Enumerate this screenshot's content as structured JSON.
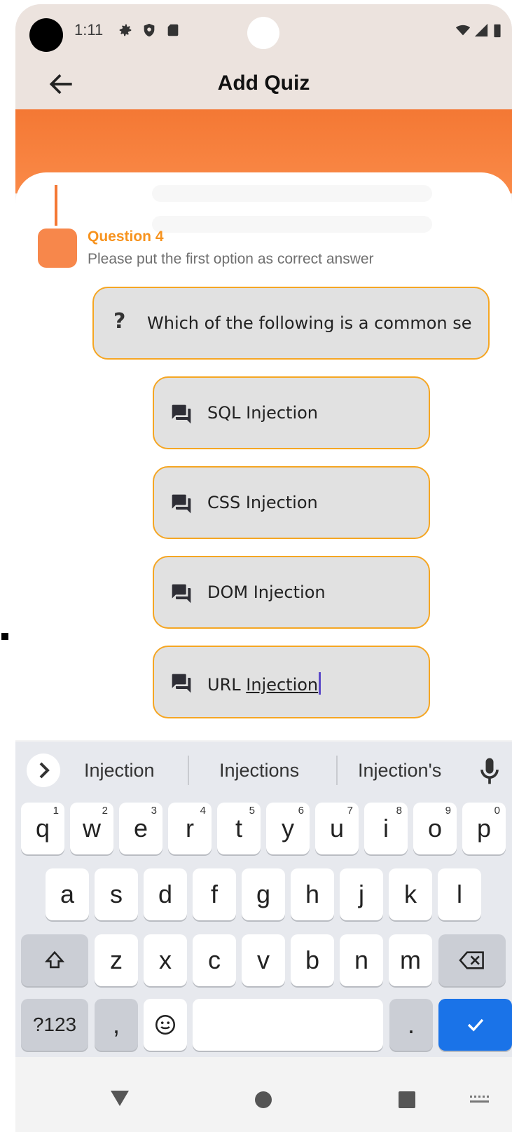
{
  "status": {
    "time": "1:11"
  },
  "appbar": {
    "title": "Add Quiz"
  },
  "question": {
    "title": "Question 4",
    "hint": "Please put the first option as correct answer",
    "prefix": "?",
    "text": "Which of the following is a common se"
  },
  "options": [
    {
      "label": "SQL Injection"
    },
    {
      "label": "CSS Injection"
    },
    {
      "label": "DOM Injection"
    },
    {
      "label_prefix": "URL ",
      "label_word": "Injection"
    }
  ],
  "keyboard": {
    "suggestions": [
      "Injection",
      "Injections",
      "Injection's"
    ],
    "row1": [
      {
        "k": "q",
        "n": "1"
      },
      {
        "k": "w",
        "n": "2"
      },
      {
        "k": "e",
        "n": "3"
      },
      {
        "k": "r",
        "n": "4"
      },
      {
        "k": "t",
        "n": "5"
      },
      {
        "k": "y",
        "n": "6"
      },
      {
        "k": "u",
        "n": "7"
      },
      {
        "k": "i",
        "n": "8"
      },
      {
        "k": "o",
        "n": "9"
      },
      {
        "k": "p",
        "n": "0"
      }
    ],
    "row2": [
      "a",
      "s",
      "d",
      "f",
      "g",
      "h",
      "j",
      "k",
      "l"
    ],
    "row3": [
      "z",
      "x",
      "c",
      "v",
      "b",
      "n",
      "m"
    ],
    "symbols": "?123",
    "comma": ",",
    "period": "."
  },
  "colors": {
    "accent": "#f47834",
    "border": "#f5a623",
    "title_accent": "#f7931e",
    "done": "#1a73e8"
  }
}
